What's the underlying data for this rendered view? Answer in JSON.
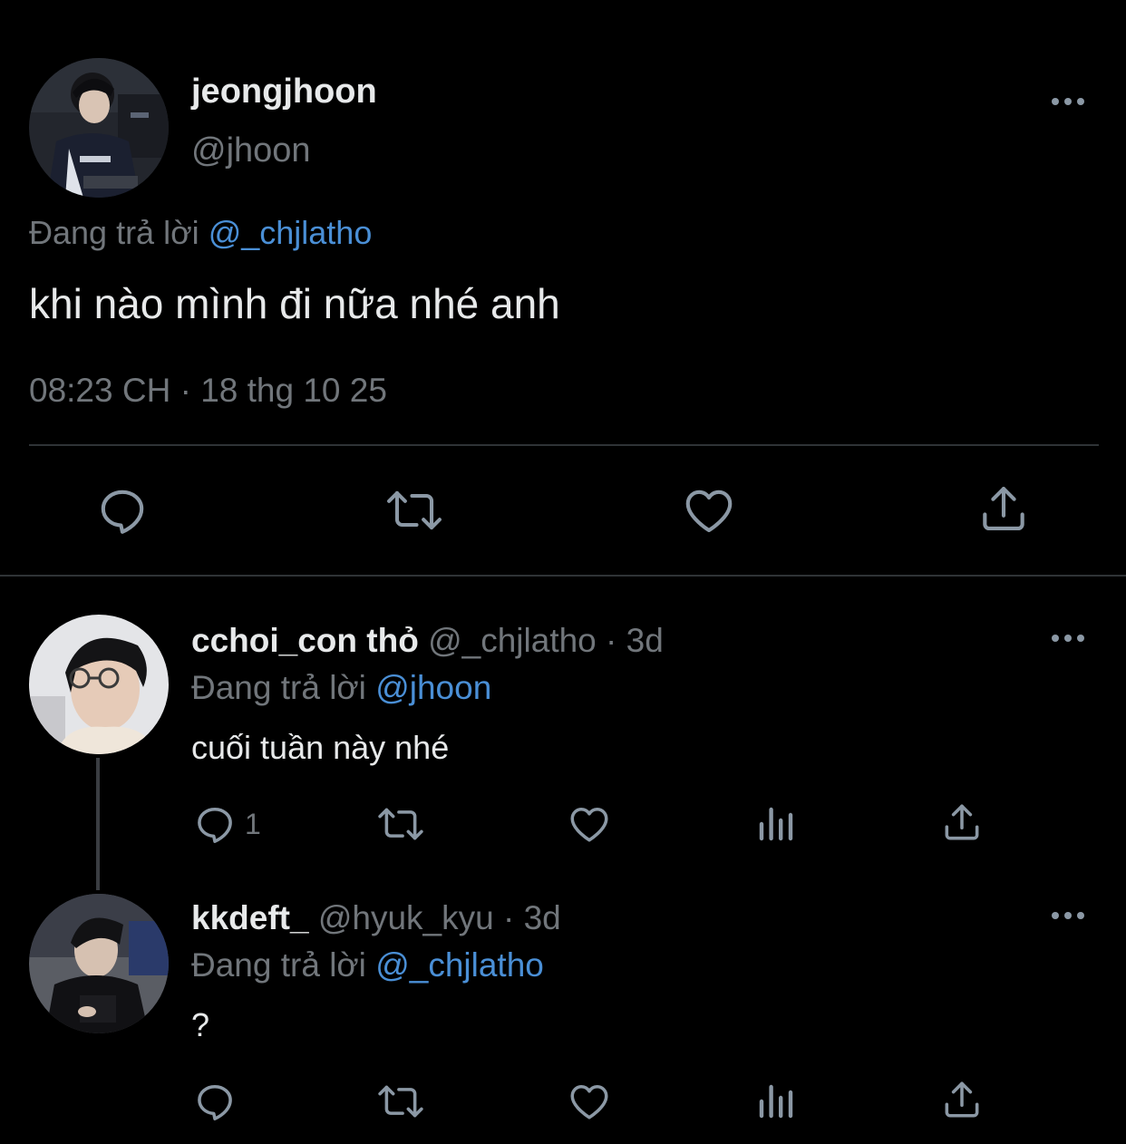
{
  "main_tweet": {
    "display_name": "jeongjhoon",
    "handle": "@jhoon",
    "replying_label": "Đang trả lời",
    "replying_to": "@_chjlatho",
    "text": "khi nào mình đi nữa nhé anh",
    "timestamp": "08:23 CH · 18 thg 10 25",
    "actions": [
      "reply-icon",
      "retweet-icon",
      "like-icon",
      "share-icon"
    ]
  },
  "replies": [
    {
      "display_name": "cchoi_con thỏ",
      "handle": "@_chjlatho",
      "time": "· 3d",
      "replying_label": "Đang trả lời",
      "replying_to": "@jhoon",
      "text": "cuối tuần này nhé",
      "reply_count": "1"
    },
    {
      "display_name": "kkdeft_",
      "handle": "@hyuk_kyu",
      "time": "· 3d",
      "replying_label": "Đang trả lời",
      "replying_to": "@_chjlatho",
      "text": "?",
      "reply_count": ""
    }
  ],
  "colors": {
    "background": "#000000",
    "text": "#e7e9ea",
    "muted": "#71767b",
    "link": "#4a8fd6",
    "divider": "#2f3336"
  }
}
